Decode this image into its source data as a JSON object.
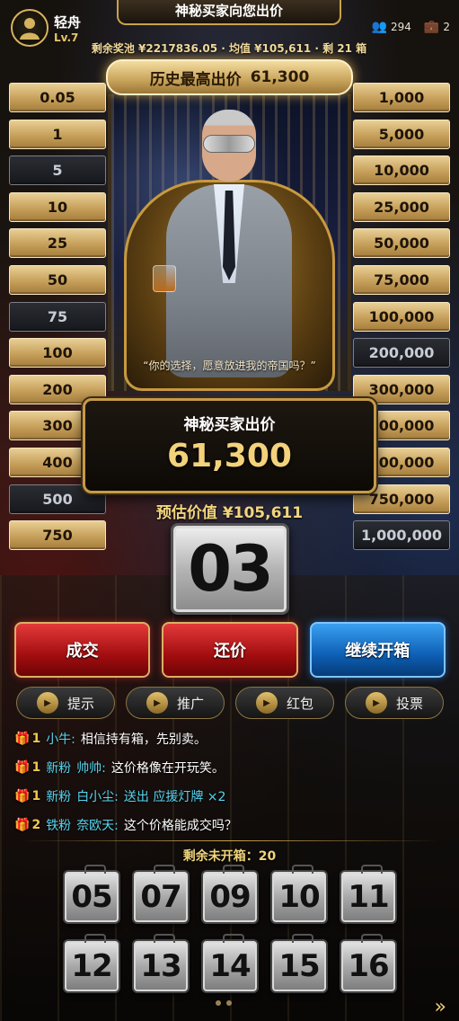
{
  "header": {
    "title": "神秘买家向您出价",
    "player_name": "轻舟",
    "player_level": "Lv.7",
    "online_count": "294",
    "case_count": "2",
    "pool_text": "剩余奖池 ¥2217836.05 · 均值 ¥105,611 · 剩 21 箱"
  },
  "highest_bid": {
    "label": "历史最高出价",
    "value": "61,300"
  },
  "left_values": [
    {
      "label": "0.05",
      "opened": false
    },
    {
      "label": "1",
      "opened": false
    },
    {
      "label": "5",
      "opened": true
    },
    {
      "label": "10",
      "opened": false
    },
    {
      "label": "25",
      "opened": false
    },
    {
      "label": "50",
      "opened": false
    },
    {
      "label": "75",
      "opened": true
    },
    {
      "label": "100",
      "opened": false
    },
    {
      "label": "200",
      "opened": false
    },
    {
      "label": "300",
      "opened": false
    },
    {
      "label": "400",
      "opened": false
    },
    {
      "label": "500",
      "opened": true
    },
    {
      "label": "750",
      "opened": false
    }
  ],
  "right_values": [
    {
      "label": "1,000",
      "opened": false
    },
    {
      "label": "5,000",
      "opened": false
    },
    {
      "label": "10,000",
      "opened": false
    },
    {
      "label": "25,000",
      "opened": false
    },
    {
      "label": "50,000",
      "opened": false
    },
    {
      "label": "75,000",
      "opened": false
    },
    {
      "label": "100,000",
      "opened": false
    },
    {
      "label": "200,000",
      "opened": true
    },
    {
      "label": "300,000",
      "opened": false
    },
    {
      "label": "400,000",
      "opened": false
    },
    {
      "label": "500,000",
      "opened": false
    },
    {
      "label": "750,000",
      "opened": false
    },
    {
      "label": "1,000,000",
      "opened": true
    }
  ],
  "buyer": {
    "quote": "“你的选择，愿意放进我的帝国吗？”"
  },
  "offer": {
    "title": "神秘买家出价",
    "amount": "61,300"
  },
  "estimate": "预估价值 ¥105,611",
  "current_case": "03",
  "actions": {
    "deal": "成交",
    "counter": "还价",
    "continue": "继续开箱"
  },
  "sub_actions": [
    "提示",
    "推广",
    "红包",
    "投票"
  ],
  "chat": [
    {
      "level": "1",
      "tag": "",
      "user": "小牛:",
      "text": "相信持有箱，先别卖。",
      "highlight": ""
    },
    {
      "level": "1",
      "tag": "新粉",
      "user": "帅帅:",
      "text": "这价格像在开玩笑。",
      "highlight": ""
    },
    {
      "level": "1",
      "tag": "新粉",
      "user": "白小尘:",
      "text": "",
      "highlight": "送出 应援灯牌 ×2"
    },
    {
      "level": "2",
      "tag": "铁粉",
      "user": "奈欧天:",
      "text": "这个价格能成交吗？",
      "highlight": ""
    }
  ],
  "remaining_label": "剩余未开箱：20",
  "cases": [
    "05",
    "07",
    "09",
    "10",
    "11",
    "12",
    "13",
    "14",
    "15",
    "16"
  ],
  "colors": {
    "gold": "#e2b84c",
    "red_button": "#a30e10",
    "blue_button": "#0d5fb5",
    "chat_cyan": "#57d6f0"
  }
}
